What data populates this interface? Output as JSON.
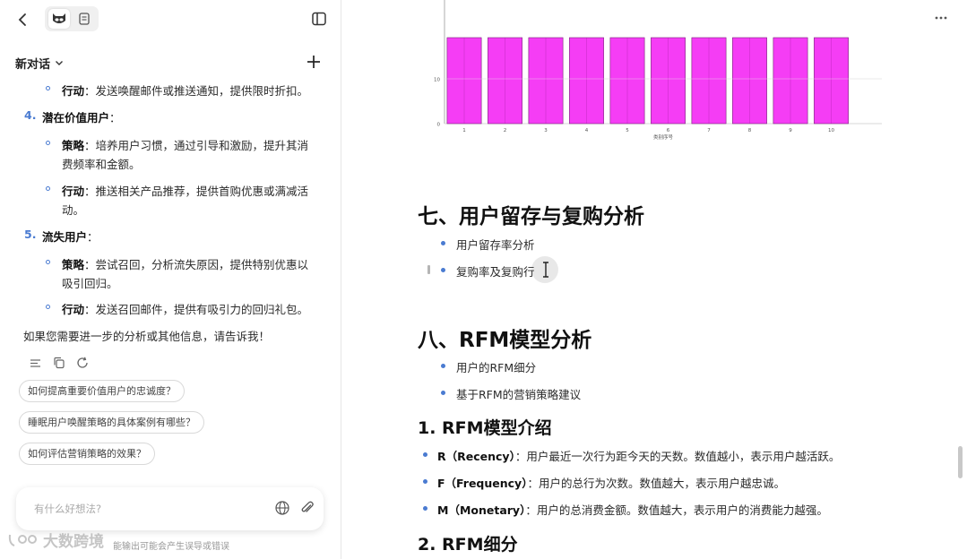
{
  "left_panel": {
    "conversation_title": "新对话",
    "messages": {
      "item3_action": {
        "label": "行动",
        "text": "：发送唤醒邮件或推送通知，提供限时折扣。"
      },
      "item4": {
        "num": "4.",
        "title": "潜在价值用户",
        "suffix": "："
      },
      "item4_strategy": {
        "label": "策略",
        "text1": "：培养用户习惯，通过引导和激励，提升其消",
        "text2": "费频率和金额。"
      },
      "item4_action": {
        "label": "行动",
        "text1": "：推送相关产品推荐，提供首购优惠或满减活",
        "text2": "动。"
      },
      "item5": {
        "num": "5.",
        "title": "流失用户",
        "suffix": "："
      },
      "item5_strategy": {
        "label": "策略",
        "text1": "：尝试召回，分析流失原因，提供特别优惠以",
        "text2": "吸引回归。"
      },
      "item5_action": {
        "label": "行动",
        "text": "：发送召回邮件，提供有吸引力的回归礼包。"
      },
      "closing": "如果您需要进一步的分析或其他信息，请告诉我！"
    },
    "suggestions": [
      "如何提高重要价值用户的忠诚度？",
      "睡眠用户唤醒策略的具体案例有哪些？",
      "如何评估营销策略的效果？"
    ],
    "input_placeholder": "有什么好想法?",
    "disclaimer": "能输出可能会产生误导或错误",
    "watermark": "大数跨境"
  },
  "right_panel": {
    "section7_title": "七、用户留存与复购分析",
    "section7_items": [
      "用户留存率分析",
      "复购率及复购行"
    ],
    "section8_title": "八、RFM模型分析",
    "section8_items": [
      "用户的RFM细分",
      "基于RFM的营销策略建议"
    ],
    "sub1_title": "1. RFM模型介绍",
    "rfm_items": [
      {
        "term": "R（Recency）",
        "desc": "：用户最近一次行为距今天的天数。数值越小，表示用户越活跃。"
      },
      {
        "term": "F（Frequency）",
        "desc": "：用户的总行为次数。数值越大，表示用户越忠诚。"
      },
      {
        "term": "M（Monetary）",
        "desc": "：用户的总消费金额。数值越大，表示用户的消费能力越强。"
      }
    ],
    "sub2_title": "2. RFM细分"
  },
  "colors": {
    "accent": "#4a7bd1",
    "bar": "#f53df5"
  },
  "chart_data": {
    "type": "bar",
    "categories": [
      "1",
      "2",
      "3",
      "4",
      "5",
      "6",
      "7",
      "8",
      "9",
      "10"
    ],
    "values": [
      20,
      20,
      20,
      20,
      20,
      20,
      20,
      20,
      20,
      20
    ],
    "ylim": [
      0,
      20
    ],
    "yticks": [
      "0",
      "10"
    ],
    "xlabel": "类别序号",
    "grid": true
  }
}
